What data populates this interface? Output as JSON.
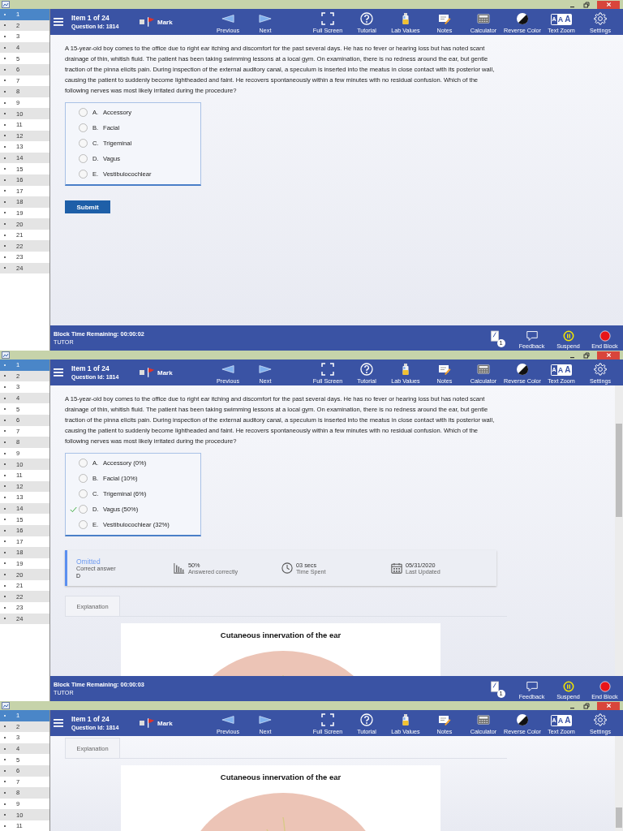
{
  "windows": [
    {
      "scrollable": false,
      "sidebar": [
        {
          "number": "1",
          "selected": true
        },
        {
          "number": "2",
          "selected": false
        },
        {
          "number": "3",
          "selected": false
        },
        {
          "number": "4",
          "selected": false
        },
        {
          "number": "5",
          "selected": false
        },
        {
          "number": "6",
          "selected": false
        },
        {
          "number": "7",
          "selected": false
        },
        {
          "number": "8",
          "selected": false
        },
        {
          "number": "9",
          "selected": false
        },
        {
          "number": "10",
          "selected": false
        },
        {
          "number": "11",
          "selected": false
        },
        {
          "number": "12",
          "selected": false
        },
        {
          "number": "13",
          "selected": false
        },
        {
          "number": "14",
          "selected": false
        },
        {
          "number": "15",
          "selected": false
        },
        {
          "number": "16",
          "selected": false
        },
        {
          "number": "17",
          "selected": false
        },
        {
          "number": "18",
          "selected": false
        },
        {
          "number": "19",
          "selected": false
        },
        {
          "number": "20",
          "selected": false
        },
        {
          "number": "21",
          "selected": false
        },
        {
          "number": "22",
          "selected": false
        },
        {
          "number": "23",
          "selected": false
        },
        {
          "number": "24",
          "selected": false
        }
      ],
      "toolbar": {
        "item": "Item 1 of 24",
        "question_id": "Question Id: 1814",
        "mark": {
          "label": "Mark",
          "checked": false
        },
        "nav": [
          {
            "kind": "previous",
            "label": "Previous"
          },
          {
            "kind": "next",
            "label": "Next"
          }
        ],
        "tools": [
          {
            "kind": "full-screen",
            "label": "Full Screen"
          },
          {
            "kind": "tutorial",
            "label": "Tutorial"
          },
          {
            "kind": "lab-values",
            "label": "Lab Values"
          },
          {
            "kind": "notes",
            "label": "Notes"
          },
          {
            "kind": "calculator",
            "label": "Calculator"
          },
          {
            "kind": "reverse-color",
            "label": "Reverse Color"
          },
          {
            "kind": "text-zoom",
            "label": "Text Zoom",
            "glyphs": [
              {
                "text": "A",
                "selected": true
              },
              {
                "text": "A",
                "selected": false
              },
              {
                "text": "A",
                "selected": false
              }
            ]
          },
          {
            "kind": "settings",
            "label": "Settings"
          }
        ]
      },
      "blocks": [
        {
          "kind": "stem",
          "text": "A 15-year-old boy comes to the office due to right ear itching and discomfort for the past several days.  He has no fever or hearing loss but has noted scant drainage of thin, whitish fluid.  The patient has been taking swimming lessons at a local gym.  On examination, there is no redness around the ear, but gentle traction of the pinna elicits pain.  During inspection of the external auditory canal, a speculum is inserted into the meatus in close contact with its posterior wall, causing the patient to suddenly become lightheaded and faint.  He recovers spontaneously within a few minutes with no residual confusion.  Which of the following nerves was most likely irritated during the procedure?"
        },
        {
          "kind": "options",
          "options": [
            {
              "letter": "A.",
              "label": "Accessory",
              "selected": false
            },
            {
              "letter": "B.",
              "label": "Facial",
              "selected": false
            },
            {
              "letter": "C.",
              "label": "Trigeminal",
              "selected": false
            },
            {
              "letter": "D.",
              "label": "Vagus",
              "selected": false
            },
            {
              "letter": "E.",
              "label": "Vestibulocochlear",
              "selected": false
            }
          ]
        },
        {
          "kind": "submit",
          "label": "Submit"
        }
      ],
      "status": {
        "time": "Block Time Remaining: 00:00:02",
        "mode": "TUTOR",
        "buttons": [
          {
            "kind": "notes",
            "badge": "1"
          },
          {
            "kind": "feedback",
            "label": "Feedback"
          },
          {
            "kind": "suspend",
            "label": "Suspend"
          },
          {
            "kind": "end",
            "label": "End Block"
          }
        ]
      }
    },
    {
      "scrollable": true,
      "sidebar": [
        {
          "number": "1",
          "selected": true
        },
        {
          "number": "2",
          "selected": false
        },
        {
          "number": "3",
          "selected": false
        },
        {
          "number": "4",
          "selected": false
        },
        {
          "number": "5",
          "selected": false
        },
        {
          "number": "6",
          "selected": false
        },
        {
          "number": "7",
          "selected": false
        },
        {
          "number": "8",
          "selected": false
        },
        {
          "number": "9",
          "selected": false
        },
        {
          "number": "10",
          "selected": false
        },
        {
          "number": "11",
          "selected": false
        },
        {
          "number": "12",
          "selected": false
        },
        {
          "number": "13",
          "selected": false
        },
        {
          "number": "14",
          "selected": false
        },
        {
          "number": "15",
          "selected": false
        },
        {
          "number": "16",
          "selected": false
        },
        {
          "number": "17",
          "selected": false
        },
        {
          "number": "18",
          "selected": false
        },
        {
          "number": "19",
          "selected": false
        },
        {
          "number": "20",
          "selected": false
        },
        {
          "number": "21",
          "selected": false
        },
        {
          "number": "22",
          "selected": false
        },
        {
          "number": "23",
          "selected": false
        },
        {
          "number": "24",
          "selected": false
        }
      ],
      "toolbar": {
        "item": "Item 1 of 24",
        "question_id": "Question Id: 1814",
        "mark": {
          "label": "Mark",
          "checked": false
        },
        "nav": [
          {
            "kind": "previous",
            "label": "Previous"
          },
          {
            "kind": "next",
            "label": "Next"
          }
        ],
        "tools": [
          {
            "kind": "full-screen",
            "label": "Full Screen"
          },
          {
            "kind": "tutorial",
            "label": "Tutorial"
          },
          {
            "kind": "lab-values",
            "label": "Lab Values"
          },
          {
            "kind": "notes",
            "label": "Notes"
          },
          {
            "kind": "calculator",
            "label": "Calculator"
          },
          {
            "kind": "reverse-color",
            "label": "Reverse Color"
          },
          {
            "kind": "text-zoom",
            "label": "Text Zoom",
            "glyphs": [
              {
                "text": "A",
                "selected": true
              },
              {
                "text": "A",
                "selected": false
              },
              {
                "text": "A",
                "selected": false
              }
            ]
          },
          {
            "kind": "settings",
            "label": "Settings"
          }
        ]
      },
      "blocks": [
        {
          "kind": "stem",
          "text": "A 15-year-old boy comes to the office due to right ear itching and discomfort for the past several days.  He has no fever or hearing loss but has noted scant drainage of thin, whitish fluid.  The patient has been taking swimming lessons at a local gym.  On examination, there is no redness around the ear, but gentle traction of the pinna elicits pain.  During inspection of the external auditory canal, a speculum is inserted into the meatus in close contact with its posterior wall, causing the patient to suddenly become lightheaded and faint.  He recovers spontaneously within a few minutes with no residual confusion.  Which of the following nerves was most likely irritated during the procedure?"
        },
        {
          "kind": "options",
          "options": [
            {
              "letter": "A.",
              "label": "Accessory (0%)",
              "selected": false,
              "correct": false
            },
            {
              "letter": "B.",
              "label": "Facial (10%)",
              "selected": false,
              "correct": false
            },
            {
              "letter": "C.",
              "label": "Trigeminal (6%)",
              "selected": false,
              "correct": false
            },
            {
              "letter": "D.",
              "label": "Vagus (50%)",
              "selected": false,
              "correct": true
            },
            {
              "letter": "E.",
              "label": "Vestibulocochlear (32%)",
              "selected": false,
              "correct": false
            }
          ]
        },
        {
          "kind": "stats",
          "status": "Omitted",
          "status_label": "Correct answer",
          "answer": "D",
          "items": [
            {
              "kind": "percent",
              "value": "50%",
              "label": "Answered correctly"
            },
            {
              "kind": "time",
              "value": "03 secs",
              "label": "Time Spent"
            },
            {
              "kind": "date",
              "value": "05/31/2020",
              "label": "Last Updated"
            }
          ]
        },
        {
          "kind": "tab",
          "label": "Explanation"
        },
        {
          "kind": "figure",
          "title": "Cutaneous innervation of the ear"
        }
      ],
      "status": {
        "time": "Block Time Remaining: 00:00:03",
        "mode": "TUTOR",
        "buttons": [
          {
            "kind": "notes",
            "badge": "1"
          },
          {
            "kind": "feedback",
            "label": "Feedback"
          },
          {
            "kind": "suspend",
            "label": "Suspend"
          },
          {
            "kind": "end",
            "label": "End Block"
          }
        ]
      }
    },
    {
      "scrollable": true,
      "sidebar": [
        {
          "number": "1",
          "selected": true
        },
        {
          "number": "2",
          "selected": false
        },
        {
          "number": "3",
          "selected": false
        },
        {
          "number": "4",
          "selected": false
        },
        {
          "number": "5",
          "selected": false
        },
        {
          "number": "6",
          "selected": false
        },
        {
          "number": "7",
          "selected": false
        },
        {
          "number": "8",
          "selected": false
        },
        {
          "number": "9",
          "selected": false
        },
        {
          "number": "10",
          "selected": false
        },
        {
          "number": "11",
          "selected": false
        }
      ],
      "toolbar": {
        "item": "Item 1 of 24",
        "question_id": "Question Id: 1814",
        "mark": {
          "label": "Mark",
          "checked": false
        },
        "nav": [
          {
            "kind": "previous",
            "label": "Previous"
          },
          {
            "kind": "next",
            "label": "Next"
          }
        ],
        "tools": [
          {
            "kind": "full-screen",
            "label": "Full Screen"
          },
          {
            "kind": "tutorial",
            "label": "Tutorial"
          },
          {
            "kind": "lab-values",
            "label": "Lab Values"
          },
          {
            "kind": "notes",
            "label": "Notes"
          },
          {
            "kind": "calculator",
            "label": "Calculator"
          },
          {
            "kind": "reverse-color",
            "label": "Reverse Color"
          },
          {
            "kind": "text-zoom",
            "label": "Text Zoom",
            "glyphs": [
              {
                "text": "A",
                "selected": true
              },
              {
                "text": "A",
                "selected": false
              },
              {
                "text": "A",
                "selected": false
              }
            ]
          },
          {
            "kind": "settings",
            "label": "Settings"
          }
        ]
      },
      "blocks": [
        {
          "kind": "tab",
          "label": "Explanation"
        },
        {
          "kind": "figure",
          "title": "Cutaneous innervation of the ear"
        }
      ]
    }
  ]
}
